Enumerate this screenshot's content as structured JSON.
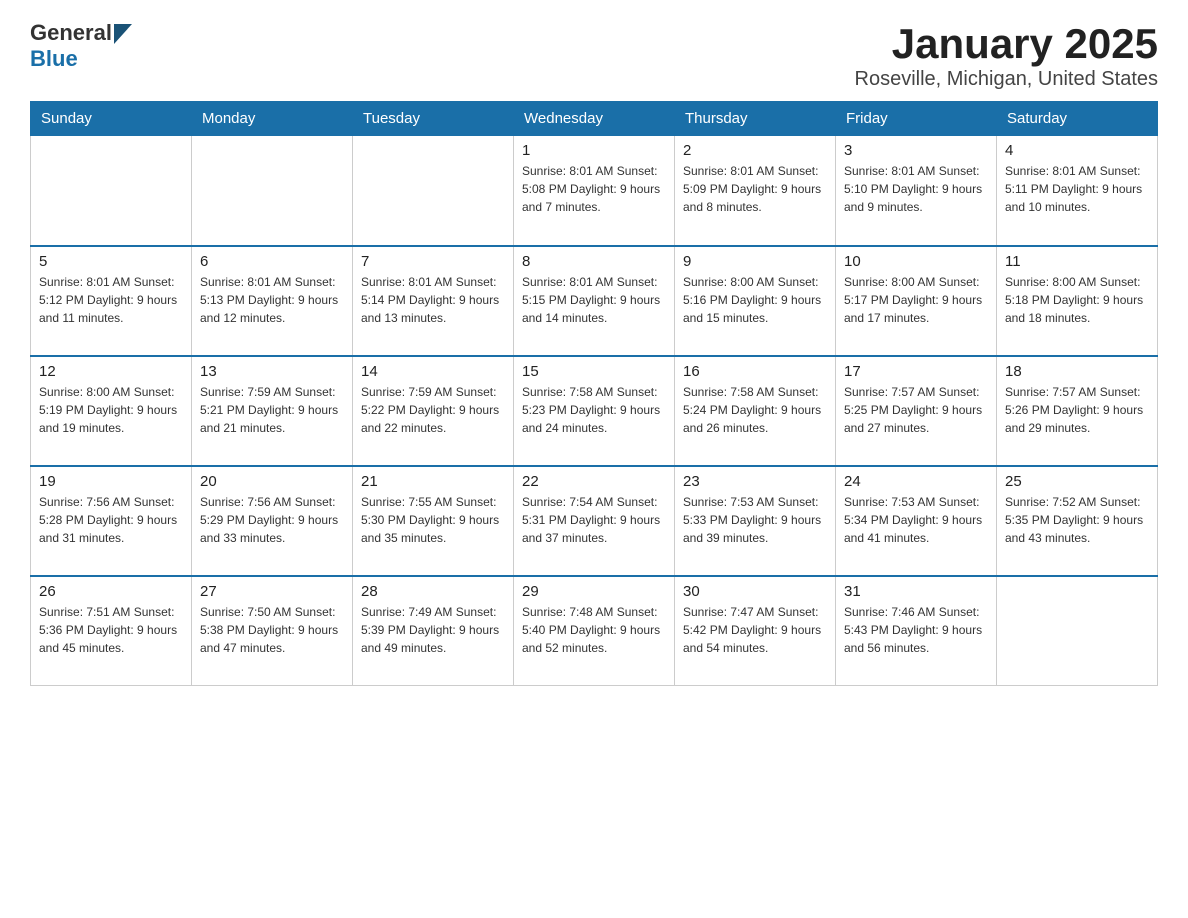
{
  "header": {
    "logo_general": "General",
    "logo_blue": "Blue",
    "title": "January 2025",
    "subtitle": "Roseville, Michigan, United States"
  },
  "days_of_week": [
    "Sunday",
    "Monday",
    "Tuesday",
    "Wednesday",
    "Thursday",
    "Friday",
    "Saturday"
  ],
  "weeks": [
    [
      {
        "day": "",
        "info": ""
      },
      {
        "day": "",
        "info": ""
      },
      {
        "day": "",
        "info": ""
      },
      {
        "day": "1",
        "info": "Sunrise: 8:01 AM\nSunset: 5:08 PM\nDaylight: 9 hours and 7 minutes."
      },
      {
        "day": "2",
        "info": "Sunrise: 8:01 AM\nSunset: 5:09 PM\nDaylight: 9 hours and 8 minutes."
      },
      {
        "day": "3",
        "info": "Sunrise: 8:01 AM\nSunset: 5:10 PM\nDaylight: 9 hours and 9 minutes."
      },
      {
        "day": "4",
        "info": "Sunrise: 8:01 AM\nSunset: 5:11 PM\nDaylight: 9 hours and 10 minutes."
      }
    ],
    [
      {
        "day": "5",
        "info": "Sunrise: 8:01 AM\nSunset: 5:12 PM\nDaylight: 9 hours and 11 minutes."
      },
      {
        "day": "6",
        "info": "Sunrise: 8:01 AM\nSunset: 5:13 PM\nDaylight: 9 hours and 12 minutes."
      },
      {
        "day": "7",
        "info": "Sunrise: 8:01 AM\nSunset: 5:14 PM\nDaylight: 9 hours and 13 minutes."
      },
      {
        "day": "8",
        "info": "Sunrise: 8:01 AM\nSunset: 5:15 PM\nDaylight: 9 hours and 14 minutes."
      },
      {
        "day": "9",
        "info": "Sunrise: 8:00 AM\nSunset: 5:16 PM\nDaylight: 9 hours and 15 minutes."
      },
      {
        "day": "10",
        "info": "Sunrise: 8:00 AM\nSunset: 5:17 PM\nDaylight: 9 hours and 17 minutes."
      },
      {
        "day": "11",
        "info": "Sunrise: 8:00 AM\nSunset: 5:18 PM\nDaylight: 9 hours and 18 minutes."
      }
    ],
    [
      {
        "day": "12",
        "info": "Sunrise: 8:00 AM\nSunset: 5:19 PM\nDaylight: 9 hours and 19 minutes."
      },
      {
        "day": "13",
        "info": "Sunrise: 7:59 AM\nSunset: 5:21 PM\nDaylight: 9 hours and 21 minutes."
      },
      {
        "day": "14",
        "info": "Sunrise: 7:59 AM\nSunset: 5:22 PM\nDaylight: 9 hours and 22 minutes."
      },
      {
        "day": "15",
        "info": "Sunrise: 7:58 AM\nSunset: 5:23 PM\nDaylight: 9 hours and 24 minutes."
      },
      {
        "day": "16",
        "info": "Sunrise: 7:58 AM\nSunset: 5:24 PM\nDaylight: 9 hours and 26 minutes."
      },
      {
        "day": "17",
        "info": "Sunrise: 7:57 AM\nSunset: 5:25 PM\nDaylight: 9 hours and 27 minutes."
      },
      {
        "day": "18",
        "info": "Sunrise: 7:57 AM\nSunset: 5:26 PM\nDaylight: 9 hours and 29 minutes."
      }
    ],
    [
      {
        "day": "19",
        "info": "Sunrise: 7:56 AM\nSunset: 5:28 PM\nDaylight: 9 hours and 31 minutes."
      },
      {
        "day": "20",
        "info": "Sunrise: 7:56 AM\nSunset: 5:29 PM\nDaylight: 9 hours and 33 minutes."
      },
      {
        "day": "21",
        "info": "Sunrise: 7:55 AM\nSunset: 5:30 PM\nDaylight: 9 hours and 35 minutes."
      },
      {
        "day": "22",
        "info": "Sunrise: 7:54 AM\nSunset: 5:31 PM\nDaylight: 9 hours and 37 minutes."
      },
      {
        "day": "23",
        "info": "Sunrise: 7:53 AM\nSunset: 5:33 PM\nDaylight: 9 hours and 39 minutes."
      },
      {
        "day": "24",
        "info": "Sunrise: 7:53 AM\nSunset: 5:34 PM\nDaylight: 9 hours and 41 minutes."
      },
      {
        "day": "25",
        "info": "Sunrise: 7:52 AM\nSunset: 5:35 PM\nDaylight: 9 hours and 43 minutes."
      }
    ],
    [
      {
        "day": "26",
        "info": "Sunrise: 7:51 AM\nSunset: 5:36 PM\nDaylight: 9 hours and 45 minutes."
      },
      {
        "day": "27",
        "info": "Sunrise: 7:50 AM\nSunset: 5:38 PM\nDaylight: 9 hours and 47 minutes."
      },
      {
        "day": "28",
        "info": "Sunrise: 7:49 AM\nSunset: 5:39 PM\nDaylight: 9 hours and 49 minutes."
      },
      {
        "day": "29",
        "info": "Sunrise: 7:48 AM\nSunset: 5:40 PM\nDaylight: 9 hours and 52 minutes."
      },
      {
        "day": "30",
        "info": "Sunrise: 7:47 AM\nSunset: 5:42 PM\nDaylight: 9 hours and 54 minutes."
      },
      {
        "day": "31",
        "info": "Sunrise: 7:46 AM\nSunset: 5:43 PM\nDaylight: 9 hours and 56 minutes."
      },
      {
        "day": "",
        "info": ""
      }
    ]
  ]
}
